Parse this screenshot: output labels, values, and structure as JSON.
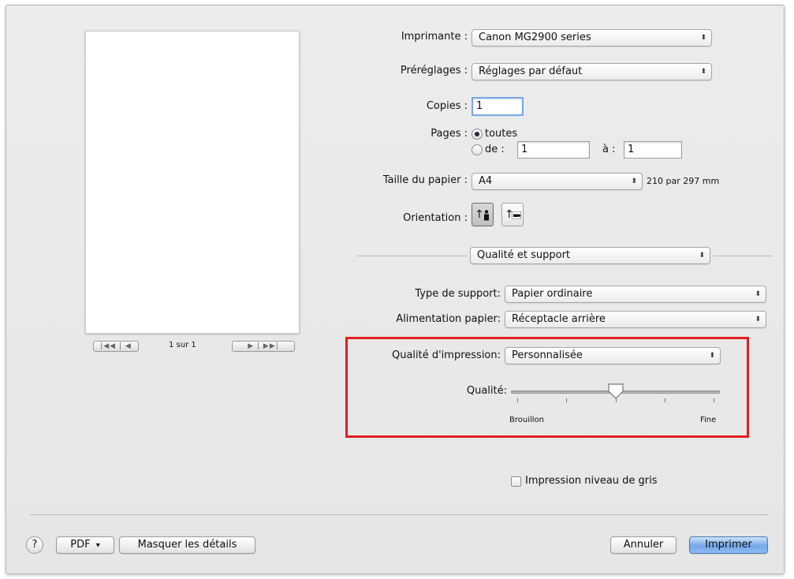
{
  "printer": {
    "label": "Imprimante :",
    "value": "Canon MG2900 series"
  },
  "presets": {
    "label": "Préréglages :",
    "value": "Réglages par défaut"
  },
  "copies": {
    "label": "Copies :",
    "value": "1"
  },
  "pages": {
    "label": "Pages :",
    "all_label": "toutes",
    "from_label": "de :",
    "from_value": "1",
    "to_label": "à :",
    "to_value": "1",
    "selected": "toutes"
  },
  "paper_size": {
    "label": "Taille du papier :",
    "value": "A4",
    "dimensions": "210 par 297 mm"
  },
  "orientation": {
    "label": "Orientation :",
    "selected": "portrait"
  },
  "section_popup": {
    "value": "Qualité et support"
  },
  "media_type": {
    "label": "Type de support:",
    "value": "Papier ordinaire"
  },
  "paper_source": {
    "label": "Alimentation papier:",
    "value": "Réceptacle arrière"
  },
  "print_quality": {
    "label": "Qualité d'impression:",
    "value": "Personnalisée"
  },
  "quality_slider": {
    "label": "Qualité:",
    "min_label": "Brouillon",
    "max_label": "Fine",
    "level": 0.5,
    "ticks": 5
  },
  "grayscale": {
    "label": "Impression niveau de gris",
    "checked": false
  },
  "preview": {
    "page_indicator": "1 sur 1",
    "first_prev": "|◀◀ | ◀",
    "next_last": "▶ | ▶▶|"
  },
  "footer": {
    "help": "?",
    "pdf": "PDF",
    "pdf_arrow": "▾",
    "hide_details": "Masquer les détails",
    "cancel": "Annuler",
    "print": "Imprimer"
  },
  "icons": {
    "popup_arrows": "⬍",
    "orient_arrow": "↑"
  }
}
